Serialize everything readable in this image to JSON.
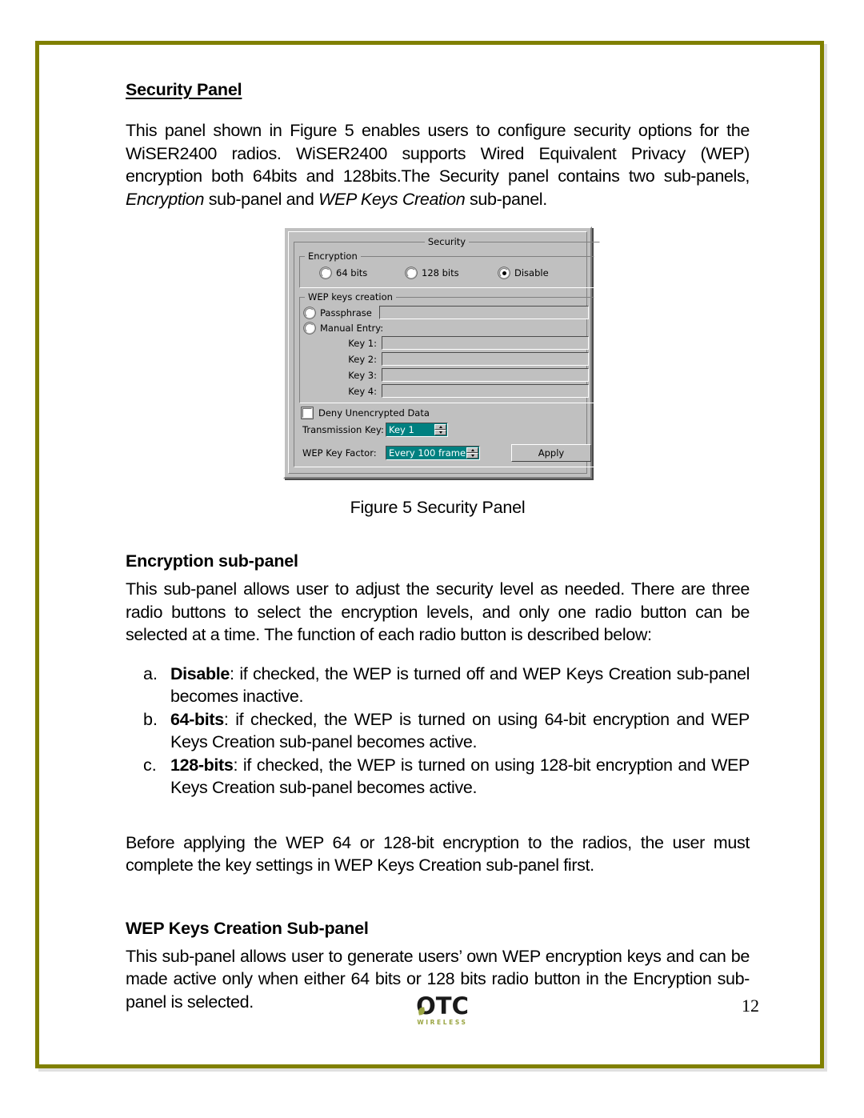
{
  "page": {
    "number": "12",
    "border_color": "#808000"
  },
  "sections": {
    "security_panel": {
      "heading": "Security Panel",
      "paragraph": "This panel shown in Figure 5 enables users to configure security options for the WiSER2400 radios. WiSER2400 supports Wired Equivalent Privacy (WEP) encryption both 64bits and 128bits.The Security panel contains two sub-panels, ",
      "paragraph_italic_1": "Encryption",
      "paragraph_mid": " sub-panel and ",
      "paragraph_italic_2": "WEP Keys Creation",
      "paragraph_end": " sub-panel."
    },
    "figure": {
      "caption": "Figure 5 Security Panel"
    },
    "encryption_subpanel": {
      "heading": "Encryption sub-panel",
      "paragraph": "This sub-panel allows user to adjust the security level as needed. There are three radio buttons to select the encryption levels, and only one radio button can be selected at a time. The function of each radio button is described below:",
      "list": [
        {
          "marker": "a.",
          "term": "Disable",
          "text": ": if checked, the WEP is turned off and WEP Keys Creation sub-panel becomes inactive."
        },
        {
          "marker": "b.",
          "term": "64-bits",
          "text": ": if checked, the WEP is turned on using 64-bit encryption and WEP Keys Creation sub-panel becomes active."
        },
        {
          "marker": "c.",
          "term": "128-bits",
          "text": ": if checked, the WEP is turned on using 128-bit encryption and WEP Keys Creation sub-panel becomes active."
        }
      ],
      "closing_paragraph": "Before applying the WEP 64 or 128-bit encryption to the radios, the user must complete the key settings in WEP Keys Creation sub-panel first."
    },
    "wep_keys_subpanel": {
      "heading": "WEP Keys Creation Sub-panel",
      "paragraph": "This sub-panel allows user to generate users’ own WEP encryption keys and can be made active only when either 64 bits or 128 bits radio button in the Encryption sub-panel is selected."
    }
  },
  "dialog": {
    "group_title": "Security",
    "encryption": {
      "legend": "Encryption",
      "options": [
        {
          "label": "64 bits",
          "selected": false
        },
        {
          "label": "128 bits",
          "selected": false
        },
        {
          "label": "Disable",
          "selected": true
        }
      ]
    },
    "wep_keys_creation": {
      "legend": "WEP keys creation",
      "passphrase_label": "Passphrase",
      "passphrase_value": "",
      "manual_entry_label": "Manual Entry:",
      "keys": [
        {
          "label": "Key 1:",
          "value": ""
        },
        {
          "label": "Key 2:",
          "value": ""
        },
        {
          "label": "Key 3:",
          "value": ""
        },
        {
          "label": "Key 4:",
          "value": ""
        }
      ]
    },
    "deny_unencrypted_label": "Deny Unencrypted Data",
    "deny_unencrypted_checked": false,
    "transmission_key_label": "Transmission Key:",
    "transmission_key_value": "Key 1",
    "wep_key_factor_label": "WEP Key Factor:",
    "wep_key_factor_value": "Every 100 frame",
    "apply_label": "Apply",
    "highlight_color": "#008080"
  },
  "footer": {
    "logo_text": "OTC",
    "logo_tagline": "WIRELESS",
    "logo_accent": "#9aa542"
  }
}
